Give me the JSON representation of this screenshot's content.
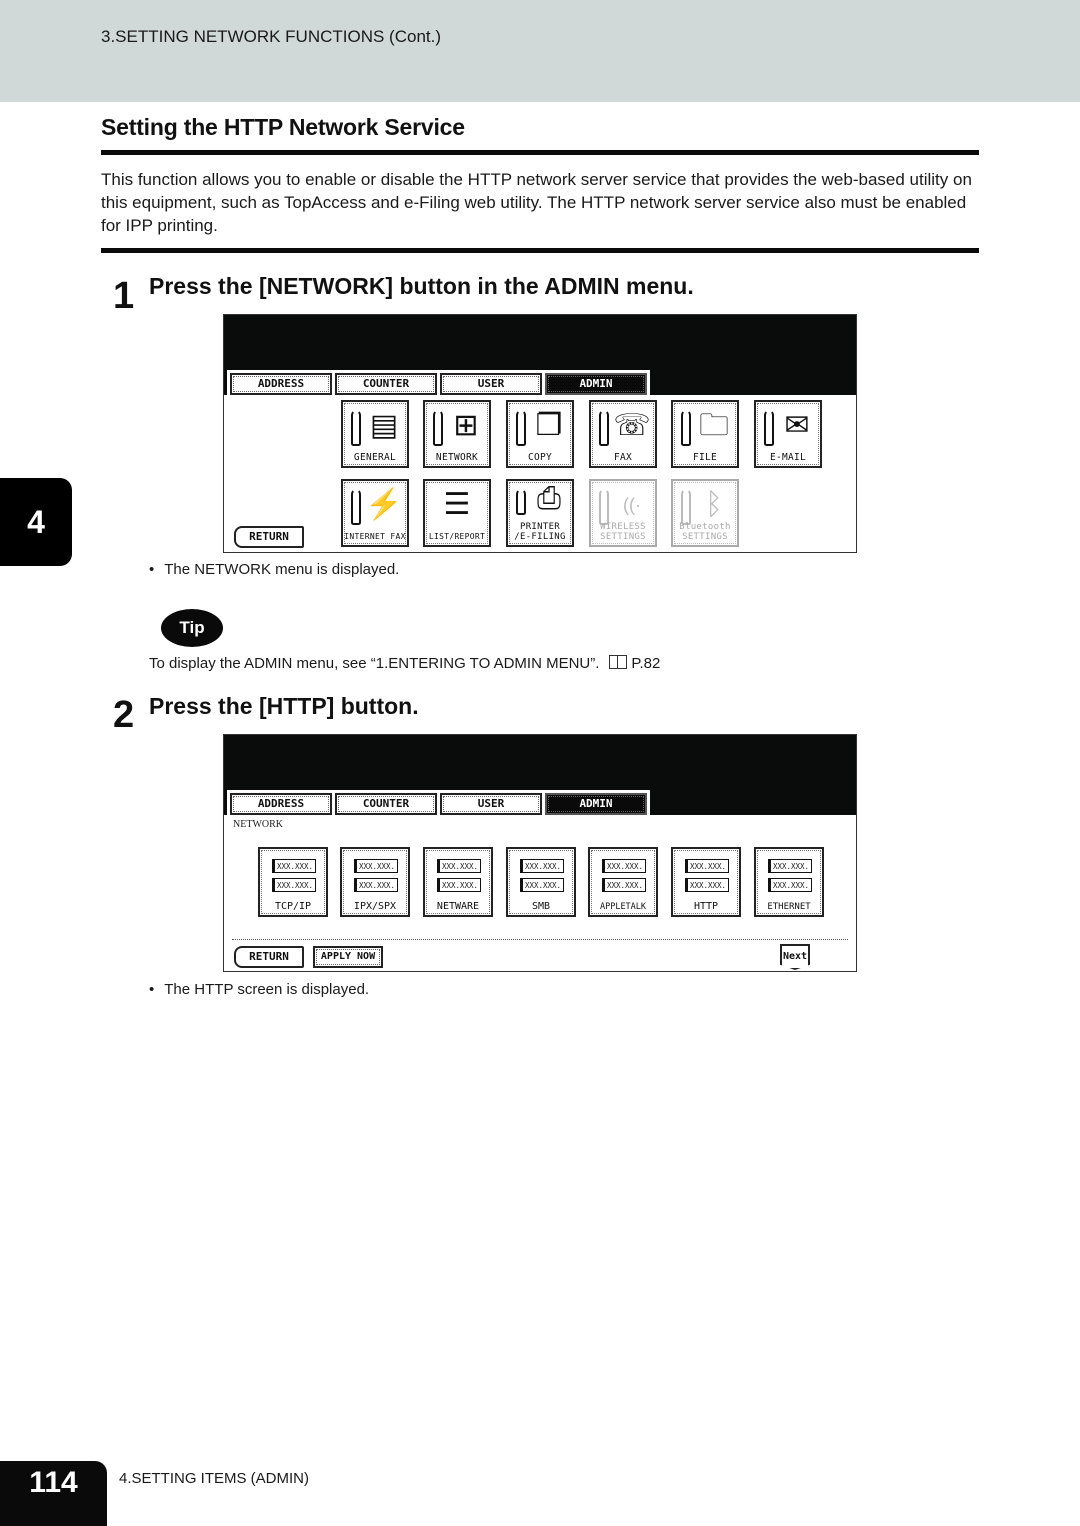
{
  "header": {
    "section": "3.SETTING NETWORK FUNCTIONS (Cont.)"
  },
  "title": "Setting the HTTP Network Service",
  "intro": "This function allows you to enable or disable the HTTP network server service that provides the web-based utility on this equipment, such as TopAccess and e-Filing web utility. The HTTP network server service also must be enabled for IPP printing.",
  "chapter_tab": "4",
  "steps": [
    {
      "number": "1",
      "text": "Press the [NETWORK] button in the ADMIN menu.",
      "result": "The NETWORK menu is displayed.",
      "screen": {
        "tabs": [
          "ADDRESS",
          "COUNTER",
          "USER",
          "ADMIN"
        ],
        "active_tab": "ADMIN",
        "buttons_row1": [
          {
            "label": "GENERAL",
            "icon": "printer-icon",
            "glyph": "▤"
          },
          {
            "label": "NETWORK",
            "icon": "network-icon",
            "glyph": "⊞"
          },
          {
            "label": "COPY",
            "icon": "copy-icon",
            "glyph": "❐"
          },
          {
            "label": "FAX",
            "icon": "fax-icon",
            "glyph": "☏"
          },
          {
            "label": "FILE",
            "icon": "folder-icon",
            "glyph": "🗀"
          },
          {
            "label": "E-MAIL",
            "icon": "email-icon",
            "glyph": "✉"
          }
        ],
        "buttons_row2": [
          {
            "label": "INTERNET FAX",
            "icon": "internet-fax-icon",
            "glyph": "⚡"
          },
          {
            "label": "LIST/REPORT",
            "icon": "list-report-icon",
            "glyph": "☰"
          },
          {
            "label": "PRINTER /E-FILING",
            "icon": "printer-efiling-icon",
            "glyph": "⎙"
          },
          {
            "label": "WIRELESS SETTINGS",
            "icon": "wireless-icon",
            "glyph": "((·",
            "disabled": true
          },
          {
            "label": "Bluetooth SETTINGS",
            "icon": "bluetooth-icon",
            "glyph": "ᛒ",
            "disabled": true
          }
        ],
        "return_label": "RETURN"
      }
    },
    {
      "number": "2",
      "text": "Press the [HTTP] button.",
      "result": "The HTTP screen is displayed.",
      "screen": {
        "tabs": [
          "ADDRESS",
          "COUNTER",
          "USER",
          "ADMIN"
        ],
        "active_tab": "ADMIN",
        "caption": "NETWORK",
        "field_placeholder": "XXX.XXX.",
        "buttons": [
          "TCP/IP",
          "IPX/SPX",
          "NETWARE",
          "SMB",
          "APPLETALK",
          "HTTP",
          "ETHERNET"
        ],
        "return_label": "RETURN",
        "apply_label": "APPLY NOW",
        "next_label": "Next"
      }
    }
  ],
  "tip": {
    "badge": "Tip",
    "text": "To display the ADMIN menu, see “1.ENTERING TO ADMIN MENU”.",
    "page_ref": "P.82"
  },
  "footer": {
    "page_number": "114",
    "chapter": "4.SETTING ITEMS (ADMIN)"
  }
}
